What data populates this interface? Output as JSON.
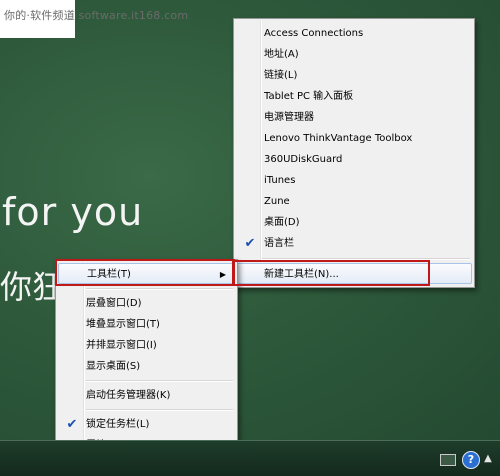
{
  "watermark": {
    "text": "你的·软件频道 software.it168.com"
  },
  "wallpaper": {
    "line1": "for you",
    "line2": "你狂"
  },
  "context_menu": {
    "items": [
      {
        "label": "工具栏(T)",
        "submenu": true,
        "highlighted": true
      },
      {
        "label": "层叠窗口(D)"
      },
      {
        "label": "堆叠显示窗口(T)"
      },
      {
        "label": "并排显示窗口(I)"
      },
      {
        "label": "显示桌面(S)"
      },
      {
        "label": "启动任务管理器(K)"
      },
      {
        "label": "锁定任务栏(L)",
        "checked": true
      },
      {
        "label": "属性(R)"
      }
    ]
  },
  "toolbars_submenu": {
    "items": [
      {
        "label": "Access Connections"
      },
      {
        "label": "地址(A)"
      },
      {
        "label": "链接(L)"
      },
      {
        "label": "Tablet PC 输入面板"
      },
      {
        "label": "电源管理器"
      },
      {
        "label": "Lenovo ThinkVantage Toolbox"
      },
      {
        "label": "360UDiskGuard"
      },
      {
        "label": "iTunes"
      },
      {
        "label": "Zune"
      },
      {
        "label": "桌面(D)"
      },
      {
        "label": "语言栏",
        "checked": true
      },
      {
        "label": "新建工具栏(N)...",
        "highlighted": true
      }
    ]
  },
  "icons": {
    "check": "✔",
    "submenu_arrow": "▶",
    "tray_help": "?",
    "tray_expand": "▲"
  },
  "colors": {
    "highlight_border": "#c01818",
    "check": "#1c4fb3",
    "desktop": "#2f5a3c"
  }
}
